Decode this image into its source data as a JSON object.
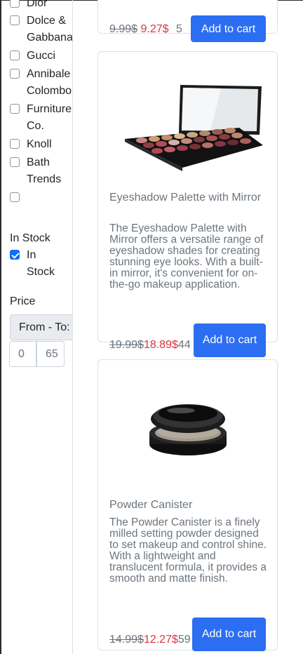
{
  "sidebar": {
    "brands": [
      {
        "label": "Dior",
        "checked": false
      },
      {
        "label": "Dolce & Gabbana",
        "checked": false
      },
      {
        "label": "Gucci",
        "checked": false
      },
      {
        "label": "Annibale Colombo",
        "checked": false
      },
      {
        "label": "Furniture Co.",
        "checked": false
      },
      {
        "label": "Knoll",
        "checked": false
      },
      {
        "label": "Bath Trends",
        "checked": false
      },
      {
        "label": "",
        "checked": false
      }
    ],
    "in_stock_title": "In Stock",
    "in_stock_option": {
      "label": "In Stock",
      "checked": true
    },
    "price_title": "Price",
    "price_range_label": "From - To:",
    "price_from": "0",
    "price_to": "65"
  },
  "products": [
    {
      "old_price": "9.99$",
      "new_price": "9.27$",
      "stock": "5",
      "add_label": "Add to cart"
    },
    {
      "title": "Eyeshadow Palette with Mirror",
      "description": "The Eyeshadow Palette with Mirror offers a versatile range of eyeshadow shades for creating stunning eye looks. With a built-in mirror, it's convenient for on-the-go makeup application.",
      "old_price": "19.99$",
      "new_price": "18.89$",
      "stock": "44",
      "add_label": "Add to cart",
      "image_icon": "eyeshadow-palette-image"
    },
    {
      "title": "Powder Canister",
      "description": "The Powder Canister is a finely milled setting powder designed to set makeup and control shine. With a lightweight and translucent formula, it provides a smooth and matte finish.",
      "old_price": "14.99$",
      "new_price": "12.27$",
      "stock": "59",
      "add_label": "Add to cart",
      "image_icon": "powder-canister-image"
    }
  ]
}
